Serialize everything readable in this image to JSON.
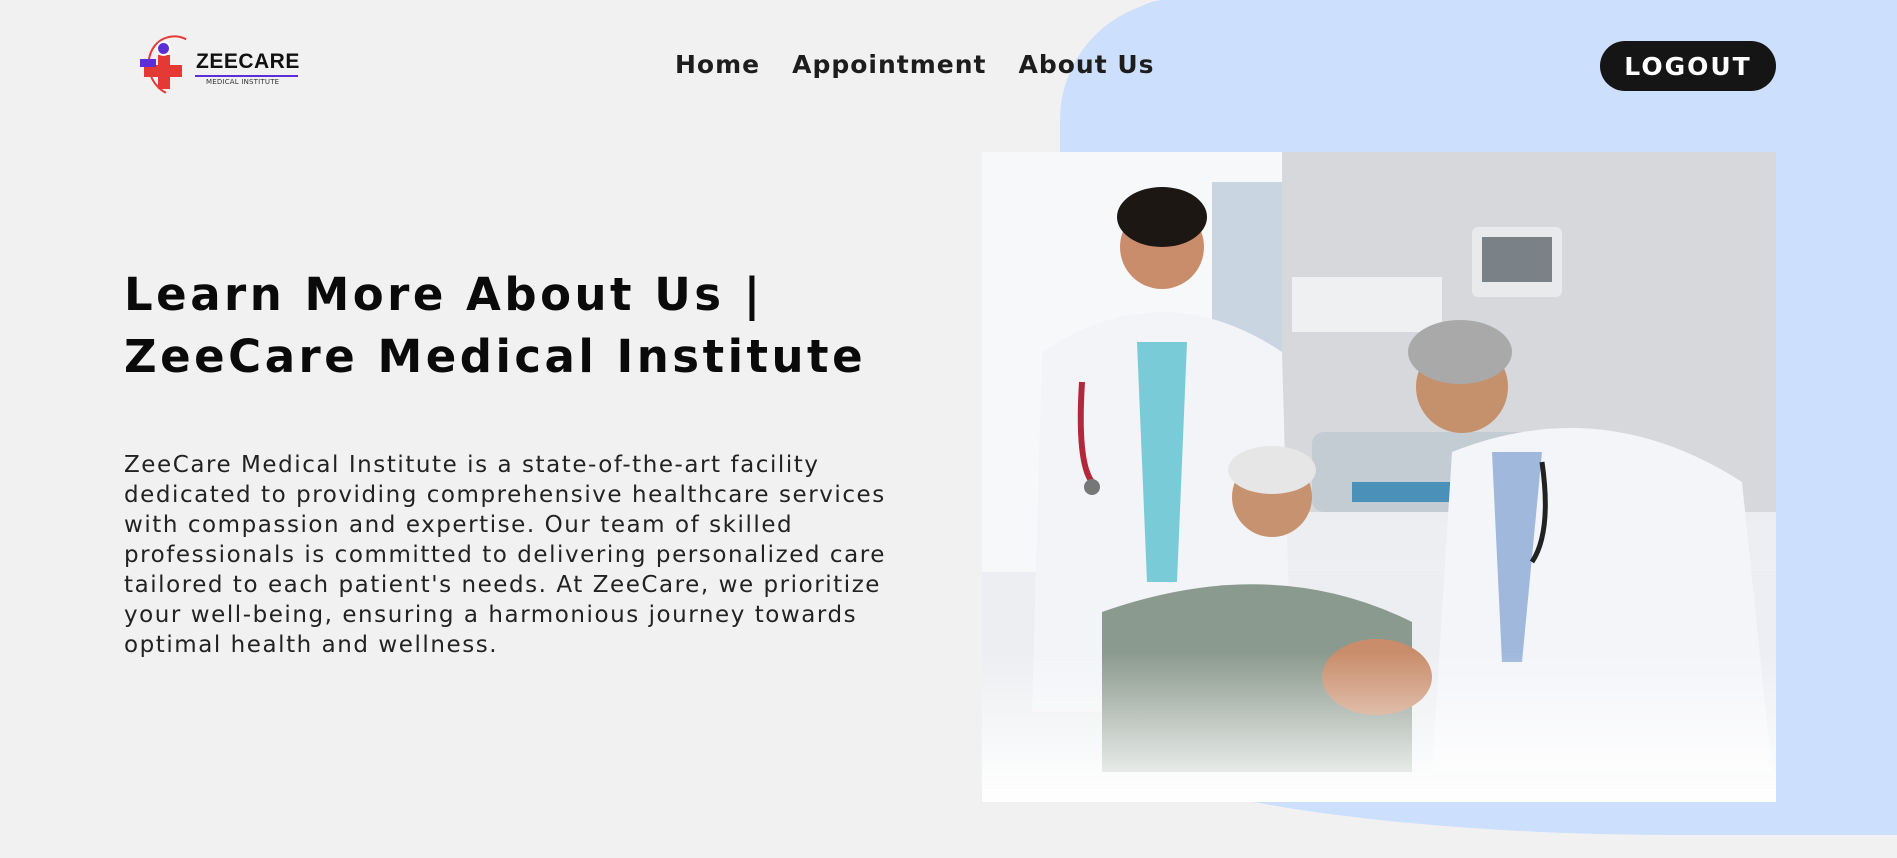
{
  "header": {
    "logo": {
      "brand": "ZEECARE",
      "subtitle": "MEDICAL INSTITUTE"
    },
    "nav": [
      {
        "label": "Home"
      },
      {
        "label": "Appointment"
      },
      {
        "label": "About Us"
      }
    ],
    "logout_label": "LOGOUT"
  },
  "hero": {
    "title_line1": "Learn More About Us |",
    "title_line2": "ZeeCare Medical Institute",
    "description": "ZeeCare Medical Institute is a state-of-the-art facility dedicated to providing comprehensive healthcare services with compassion and expertise. Our team of skilled professionals is committed to delivering personalized care tailored to each patient's needs. At ZeeCare, we prioritize your well-being, ensuring a harmonious journey towards optimal health and wellness.",
    "image": "doctors-with-patient-photo"
  },
  "colors": {
    "page_background": "#f1f1f1",
    "accent_blob": "#ccdffd",
    "button_background": "#151515",
    "logo_red": "#e53935",
    "logo_purple": "#5b2ed6"
  }
}
